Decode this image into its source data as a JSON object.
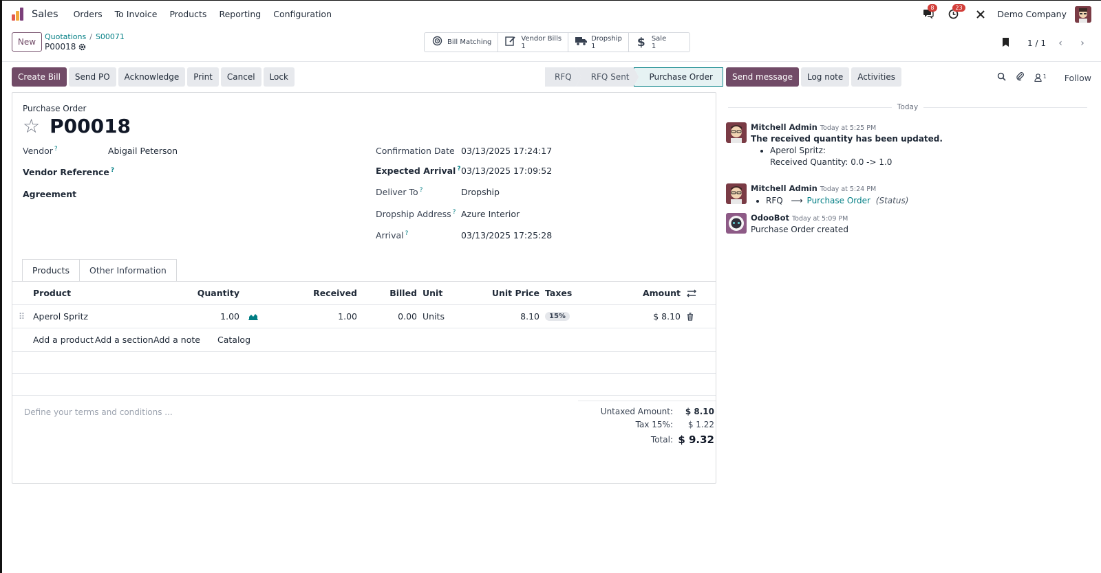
{
  "navbar": {
    "app_name": "Sales",
    "menu": [
      "Orders",
      "To Invoice",
      "Products",
      "Reporting",
      "Configuration"
    ],
    "messages_count": "8",
    "activities_count": "23",
    "company": "Demo Company"
  },
  "control": {
    "new_label": "New",
    "breadcrumb": [
      "Quotations",
      "S00071"
    ],
    "current": "P00018",
    "smart_buttons": [
      {
        "icon": "bill-matching-icon",
        "label": "Bill Matching",
        "count": ""
      },
      {
        "icon": "vendor-bills-icon",
        "label": "Vendor Bills",
        "count": "1"
      },
      {
        "icon": "truck-icon",
        "label": "Dropship",
        "count": "1"
      },
      {
        "icon": "dollar-icon",
        "label": "Sale",
        "count": "1"
      }
    ],
    "pager": "1 / 1"
  },
  "actions": [
    "Create Bill",
    "Send PO",
    "Acknowledge",
    "Print",
    "Cancel",
    "Lock"
  ],
  "status": [
    "RFQ",
    "RFQ Sent",
    "Purchase Order"
  ],
  "form": {
    "label": "Purchase Order",
    "name": "P00018",
    "left_fields": [
      {
        "label": "Vendor",
        "value": "Abigail Peterson"
      },
      {
        "label": "Vendor Reference",
        "value": ""
      },
      {
        "label": "Agreement",
        "value": ""
      }
    ],
    "right_fields": [
      {
        "label": "Confirmation Date",
        "value": "03/13/2025 17:24:17"
      },
      {
        "label": "Expected Arrival",
        "value": "03/13/2025 17:09:52"
      },
      {
        "label": "Deliver To",
        "value": "Dropship"
      },
      {
        "label": "Dropship Address",
        "value": "Azure Interior"
      },
      {
        "label": "Arrival",
        "value": "03/13/2025 17:25:28"
      }
    ],
    "tabs": [
      "Products",
      "Other Information"
    ],
    "columns": [
      "Product",
      "Quantity",
      "Received",
      "Billed",
      "Unit",
      "Unit Price",
      "Taxes",
      "Amount"
    ],
    "lines": [
      {
        "product": "Aperol Spritz",
        "quantity": "1.00",
        "received": "1.00",
        "billed": "0.00",
        "unit": "Units",
        "unit_price": "8.10",
        "taxes": "15%",
        "amount": "$ 8.10"
      }
    ],
    "add_links": [
      "Add a product",
      "Add a section",
      "Add a note",
      "Catalog"
    ],
    "terms_placeholder": "Define your terms and conditions ...",
    "totals": [
      {
        "label": "Untaxed Amount:",
        "value": "$ 8.10"
      },
      {
        "label": "Tax 15%:",
        "value": "$ 1.22"
      },
      {
        "label": "Total:",
        "value": "$ 9.32"
      }
    ]
  },
  "chatter": {
    "buttons": [
      "Send message",
      "Log note",
      "Activities"
    ],
    "followers_count": "1",
    "follow_label": "Follow",
    "day": "Today",
    "messages": [
      {
        "author": "Mitchell Admin",
        "time": "Today at 5:25 PM",
        "title": "The received quantity has been updated.",
        "item": "Aperol Spritz:",
        "detail": "Received Quantity: 0.0 -> 1.0"
      },
      {
        "author": "Mitchell Admin",
        "time": "Today at 5:24 PM",
        "from": "RFQ",
        "arrow": "⟶",
        "to": "Purchase Order",
        "field": "(Status)"
      },
      {
        "author": "OdooBot",
        "time": "Today at 5:09 PM",
        "text": "Purchase Order created"
      }
    ]
  }
}
